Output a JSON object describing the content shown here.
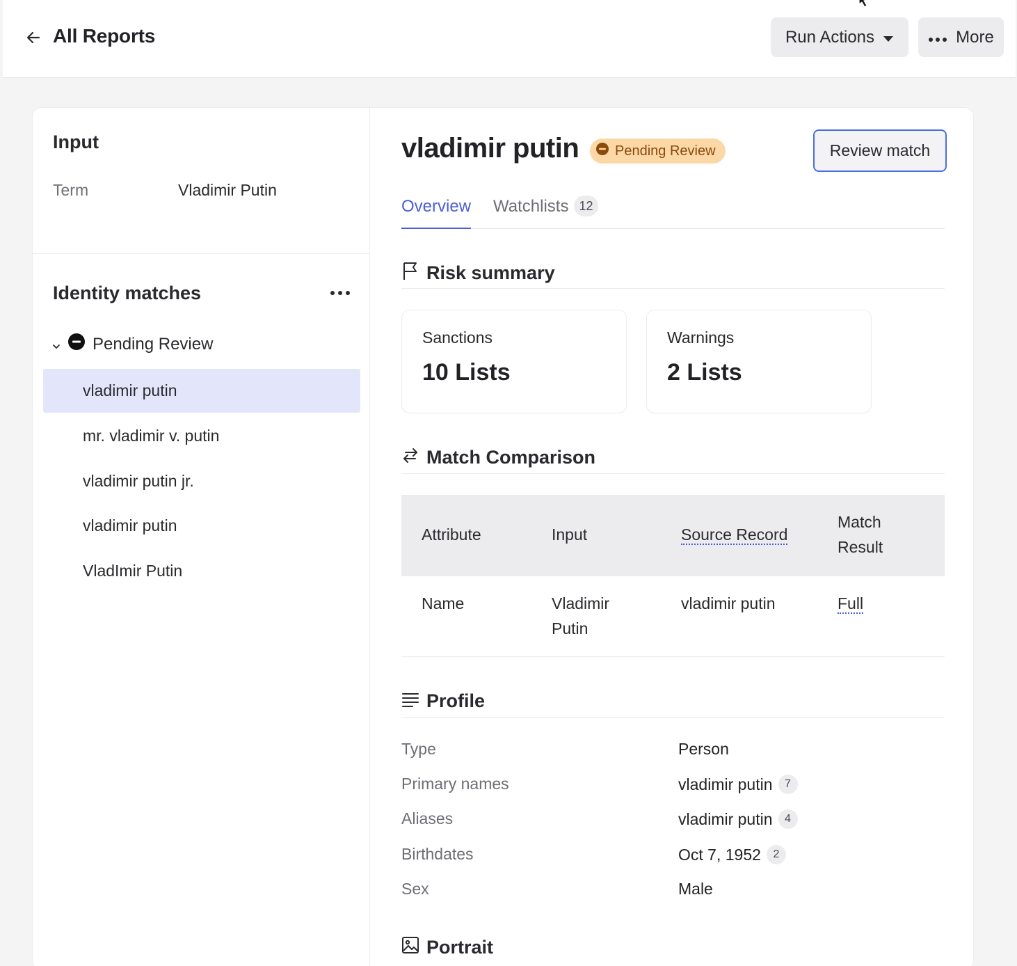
{
  "header": {
    "back_label": "All Reports",
    "run_actions_label": "Run Actions",
    "more_label": "More"
  },
  "input_panel": {
    "title": "Input",
    "term_label": "Term",
    "term_value": "Vladimir Putin"
  },
  "identity_matches": {
    "title": "Identity matches",
    "group_label": "Pending Review",
    "items": [
      {
        "label": "vladimir putin",
        "active": true
      },
      {
        "label": "mr. vladimir v. putin",
        "active": false
      },
      {
        "label": "vladimir putin jr.",
        "active": false
      },
      {
        "label": "vladimir putin",
        "active": false
      },
      {
        "label": "VladImir Putin",
        "active": false
      }
    ]
  },
  "detail": {
    "entity_name": "vladimir putin",
    "status_badge": "Pending Review",
    "review_button": "Review match",
    "tabs": [
      {
        "label": "Overview",
        "active": true
      },
      {
        "label": "Watchlists",
        "count": "12",
        "active": false
      }
    ],
    "risk_summary": {
      "title": "Risk summary",
      "cards": [
        {
          "label": "Sanctions",
          "value": "10 Lists"
        },
        {
          "label": "Warnings",
          "value": "2 Lists"
        }
      ]
    },
    "match_comparison": {
      "title": "Match Comparison",
      "columns": [
        "Attribute",
        "Input",
        "Source Record",
        "Match Result"
      ],
      "rows": [
        {
          "attribute": "Name",
          "input": "Vladimir Putin",
          "source": "vladimir putin",
          "result": "Full"
        }
      ]
    },
    "profile": {
      "title": "Profile",
      "rows": [
        {
          "label": "Type",
          "value": "Person",
          "count": ""
        },
        {
          "label": "Primary names",
          "value": "vladimir putin",
          "count": "7"
        },
        {
          "label": "Aliases",
          "value": "vladimir putin",
          "count": "4"
        },
        {
          "label": "Birthdates",
          "value": "Oct 7, 1952",
          "count": "2"
        },
        {
          "label": "Sex",
          "value": "Male",
          "count": ""
        }
      ]
    },
    "portrait": {
      "title": "Portrait"
    }
  },
  "colors": {
    "accent": "#4a5ed8",
    "badge_bg": "#fbd8a6",
    "active_item_bg": "#e3e5fb"
  }
}
